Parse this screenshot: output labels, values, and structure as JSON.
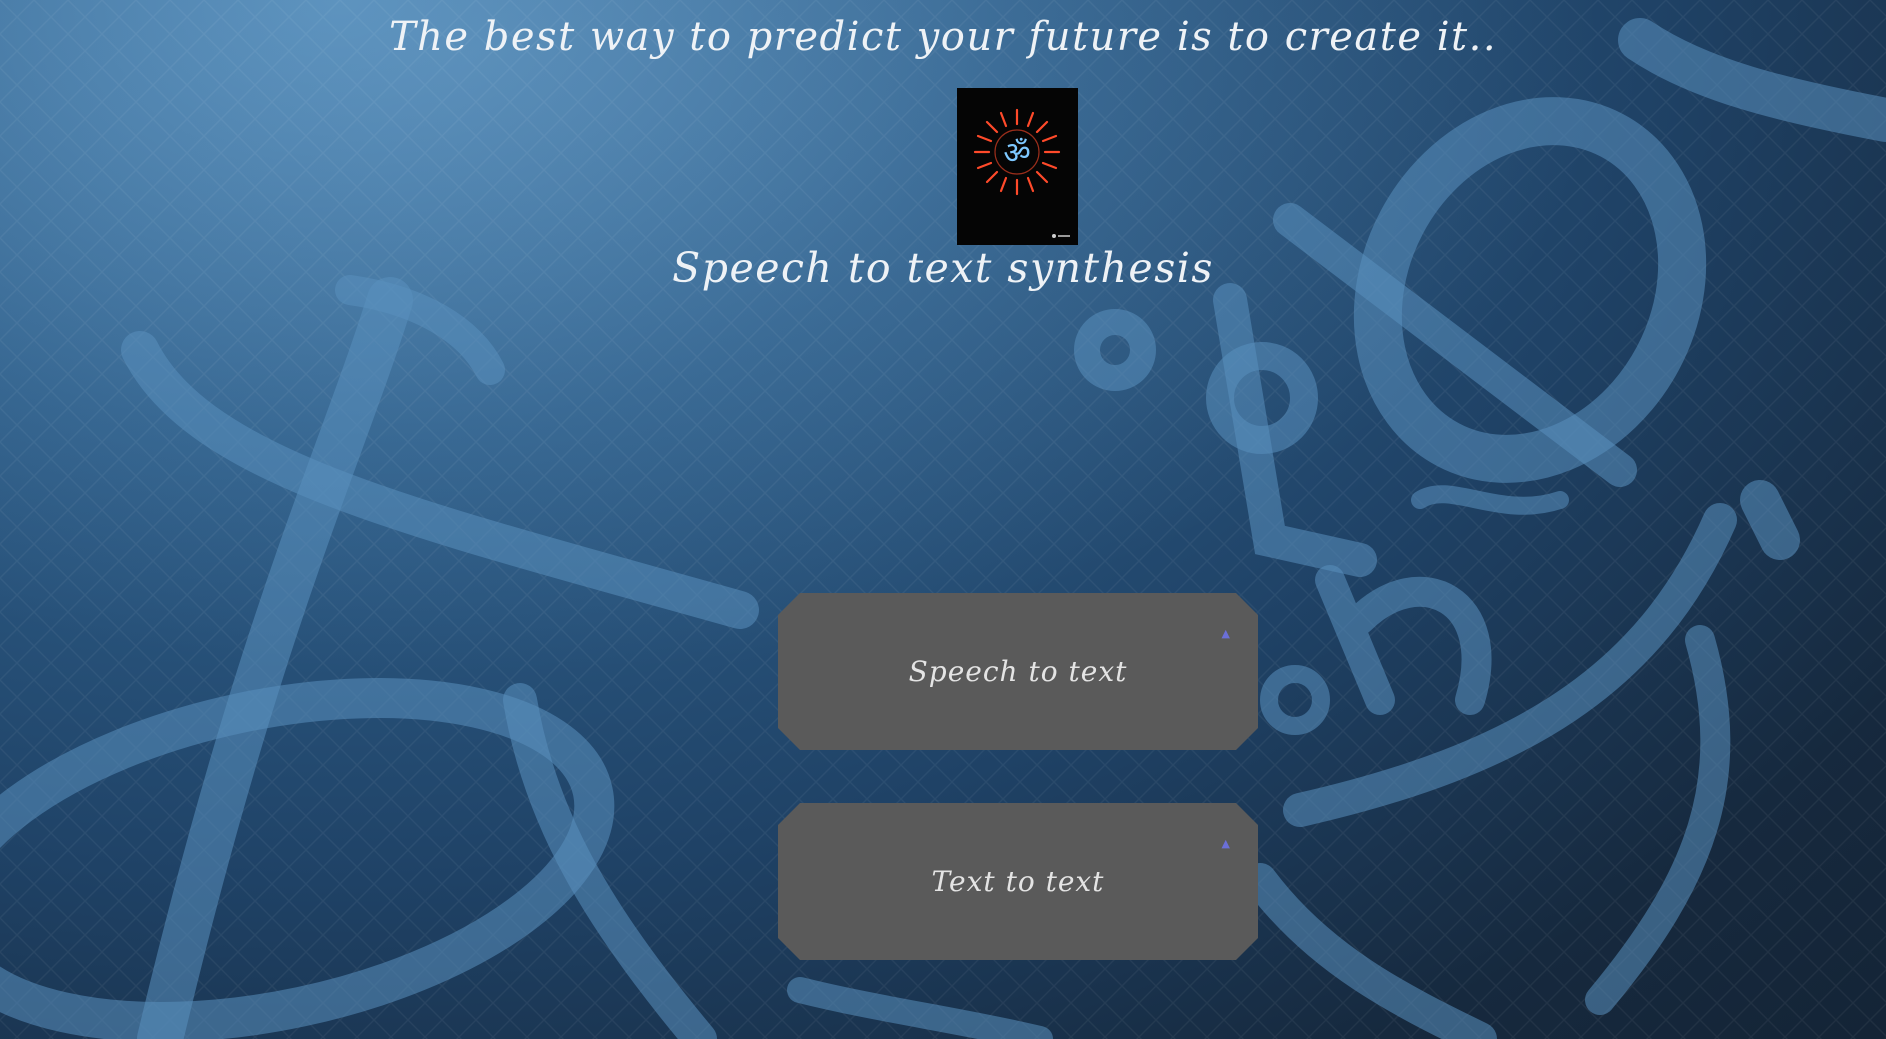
{
  "header": {
    "quote": "The best way to predict your future is to create it.."
  },
  "logo": {
    "icon": "om-neon-icon",
    "colors": {
      "sun_rays": "#ff4a2a",
      "om_glyph": "#7ec8ff",
      "background": "#050505"
    }
  },
  "main": {
    "title": "Speech to text synthesis",
    "buttons": [
      {
        "label": "Speech to text",
        "icon": "caret-up-icon"
      },
      {
        "label": "Text to text",
        "icon": "caret-up-icon"
      }
    ]
  },
  "theme": {
    "background_light": "#4f87b4",
    "background_dark": "#142436",
    "button_bg": "#5a5a5a",
    "button_text": "#e4e4e4",
    "heading_text": "#eef2f6"
  }
}
